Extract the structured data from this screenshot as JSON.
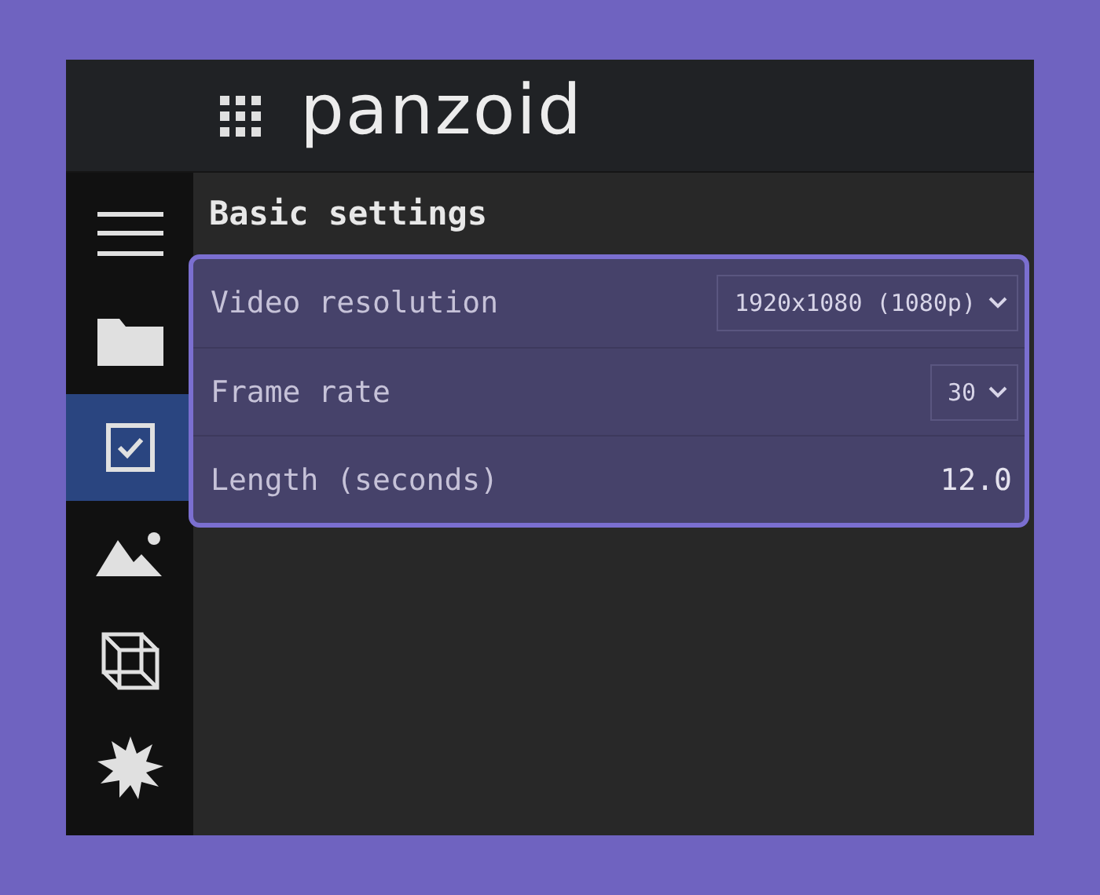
{
  "header": {
    "logo": "panzoid"
  },
  "sidebar": {
    "items": [
      {
        "kind": "menu",
        "selected": false
      },
      {
        "kind": "folder",
        "selected": false
      },
      {
        "kind": "checkbox",
        "selected": true
      },
      {
        "kind": "image",
        "selected": false
      },
      {
        "kind": "cube",
        "selected": false
      },
      {
        "kind": "burst",
        "selected": false
      }
    ]
  },
  "section": {
    "title": "Basic settings",
    "rows": [
      {
        "kind": "select",
        "label": "Video resolution",
        "value": "1920x1080 (1080p)"
      },
      {
        "kind": "select",
        "label": "Frame rate",
        "value": "30"
      },
      {
        "kind": "number",
        "label": "Length (seconds)",
        "value": "12.0"
      }
    ]
  }
}
